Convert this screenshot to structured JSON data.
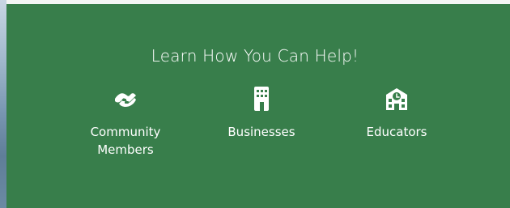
{
  "section": {
    "heading": "Learn How You Can Help!"
  },
  "options": [
    {
      "label": "Community\nMembers",
      "icon": "handshake-icon"
    },
    {
      "label": "Businesses",
      "icon": "building-icon"
    },
    {
      "label": "Educators",
      "icon": "school-icon"
    }
  ],
  "colors": {
    "panel_bg": "#387e4b",
    "text": "#ffffff",
    "top_strip": "#f4f6f4"
  }
}
